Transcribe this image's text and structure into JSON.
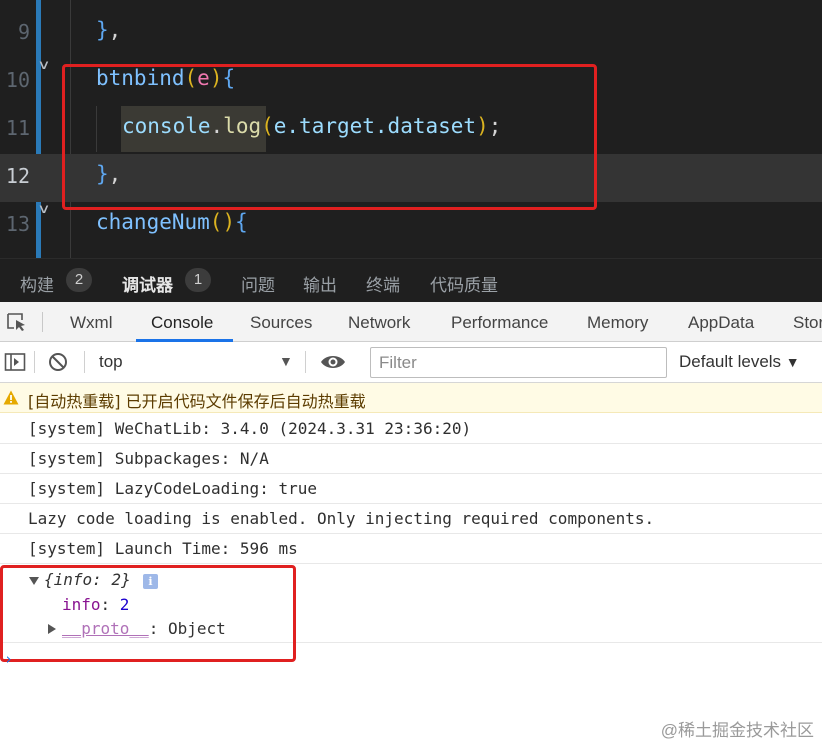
{
  "editor": {
    "lines": [
      {
        "num": "9",
        "code": "},"
      },
      {
        "num": "10",
        "fn": "btnbind",
        "param": "e"
      },
      {
        "num": "11",
        "obj": "console",
        "method": "log",
        "args": "e.target.dataset"
      },
      {
        "num": "12",
        "code": "},"
      },
      {
        "num": "13",
        "fn": "changeNum"
      }
    ],
    "current_line": "12"
  },
  "panel_tabs": [
    {
      "label": "构建",
      "badge": "2"
    },
    {
      "label": "调试器",
      "badge": "1",
      "active": true
    },
    {
      "label": "问题"
    },
    {
      "label": "输出"
    },
    {
      "label": "终端"
    },
    {
      "label": "代码质量"
    }
  ],
  "devtools_tabs": [
    "Wxml",
    "Console",
    "Sources",
    "Network",
    "Performance",
    "Memory",
    "AppData",
    "Stor"
  ],
  "devtools_active_tab": "Console",
  "toolbar": {
    "context": "top",
    "filter_placeholder": "Filter",
    "levels": "Default levels"
  },
  "console": {
    "messages": [
      {
        "type": "warn",
        "text": "[自动热重载] 已开启代码文件保存后自动热重载"
      },
      {
        "type": "log",
        "text": "[system] WeChatLib: 3.4.0 (2024.3.31 23:36:20)"
      },
      {
        "type": "log",
        "text": "[system] Subpackages: N/A"
      },
      {
        "type": "log",
        "text": "[system] LazyCodeLoading: true"
      },
      {
        "type": "log",
        "text": "Lazy code loading is enabled. Only injecting required components."
      },
      {
        "type": "log",
        "text": "[system] Launch Time: 596 ms"
      }
    ],
    "object": {
      "preview": "{info: 2}",
      "props": [
        {
          "key": "info",
          "value": "2"
        }
      ],
      "proto_key": "__proto__",
      "proto_value": "Object"
    },
    "prompt": "›"
  },
  "watermark": "@稀土掘金技术社区",
  "colors": {
    "highlight_red": "#e02020",
    "accent_blue": "#1a73e8",
    "editor_bg": "#1f1f1f"
  }
}
